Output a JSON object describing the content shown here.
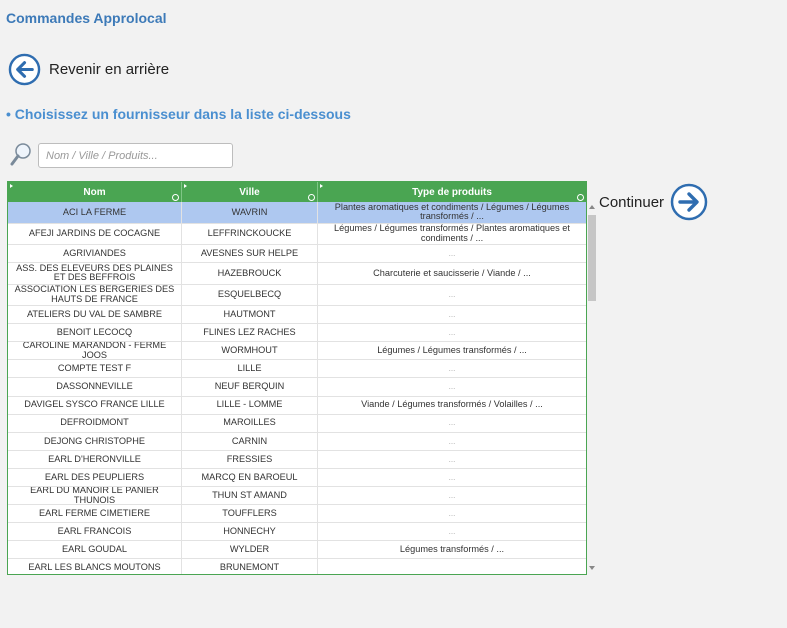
{
  "header": {
    "title": "Commandes Approlocal"
  },
  "nav": {
    "back_label": "Revenir en arrière",
    "continue_label": "Continuer"
  },
  "main": {
    "instruction": "• Choisissez un fournisseur dans la liste ci-dessous"
  },
  "search": {
    "placeholder": "Nom / Ville / Produits..."
  },
  "colors": {
    "accent": "#3d7ab8",
    "grid_header": "#4aa552",
    "selected_row": "#aec8f0"
  },
  "icons": {
    "back": "arrow-left-circle-icon",
    "continue": "arrow-right-circle-icon",
    "search": "magnifier-icon"
  },
  "table": {
    "columns": [
      "Nom",
      "Ville",
      "Type de produits"
    ],
    "rows": [
      {
        "nom": "ACI LA FERME",
        "ville": "WAVRIN",
        "type": "Plantes aromatiques et condiments / Légumes / Légumes transformés / ..."
      },
      {
        "nom": "AFEJI JARDINS DE COCAGNE",
        "ville": "LEFFRINCKOUCKE",
        "type": "Légumes / Légumes transformés / Plantes aromatiques et condiments / ..."
      },
      {
        "nom": "AGRIVIANDES",
        "ville": "AVESNES SUR HELPE",
        "type": "..."
      },
      {
        "nom": "ASS. DES ELEVEURS DES PLAINES ET DES BEFFROIS",
        "ville": "HAZEBROUCK",
        "type": "Charcuterie et saucisserie / Viande / ..."
      },
      {
        "nom": "ASSOCIATION LES BERGERIES DES HAUTS DE FRANCE",
        "ville": "ESQUELBECQ",
        "type": "..."
      },
      {
        "nom": "ATELIERS DU VAL DE SAMBRE",
        "ville": "HAUTMONT",
        "type": "..."
      },
      {
        "nom": "BENOIT LECOCQ",
        "ville": "FLINES LEZ RACHES",
        "type": "..."
      },
      {
        "nom": "CAROLINE MARANDON - FERME JOOS",
        "ville": "WORMHOUT",
        "type": "Légumes / Légumes transformés / ..."
      },
      {
        "nom": "COMPTE TEST F",
        "ville": "LILLE",
        "type": "..."
      },
      {
        "nom": "DASSONNEVILLE",
        "ville": "NEUF BERQUIN",
        "type": "..."
      },
      {
        "nom": "DAVIGEL SYSCO FRANCE LILLE",
        "ville": "LILLE - LOMME",
        "type": "Viande / Légumes transformés / Volailles / ..."
      },
      {
        "nom": "DEFROIDMONT",
        "ville": "MAROILLES",
        "type": "..."
      },
      {
        "nom": "DEJONG CHRISTOPHE",
        "ville": "CARNIN",
        "type": "..."
      },
      {
        "nom": "EARL D'HERONVILLE",
        "ville": "FRESSIES",
        "type": "..."
      },
      {
        "nom": "EARL DES PEUPLIERS",
        "ville": "MARCQ EN BAROEUL",
        "type": "..."
      },
      {
        "nom": "EARL DU MANOIR LE PANIER THUNOIS",
        "ville": "THUN ST AMAND",
        "type": "..."
      },
      {
        "nom": "EARL FERME CIMETIERE",
        "ville": "TOUFFLERS",
        "type": "..."
      },
      {
        "nom": "EARL FRANCOIS",
        "ville": "HONNECHY",
        "type": "..."
      },
      {
        "nom": "EARL GOUDAL",
        "ville": "WYLDER",
        "type": "Légumes transformés / ..."
      },
      {
        "nom": "EARL LES BLANCS MOUTONS",
        "ville": "BRUNEMONT",
        "type": ""
      }
    ]
  }
}
